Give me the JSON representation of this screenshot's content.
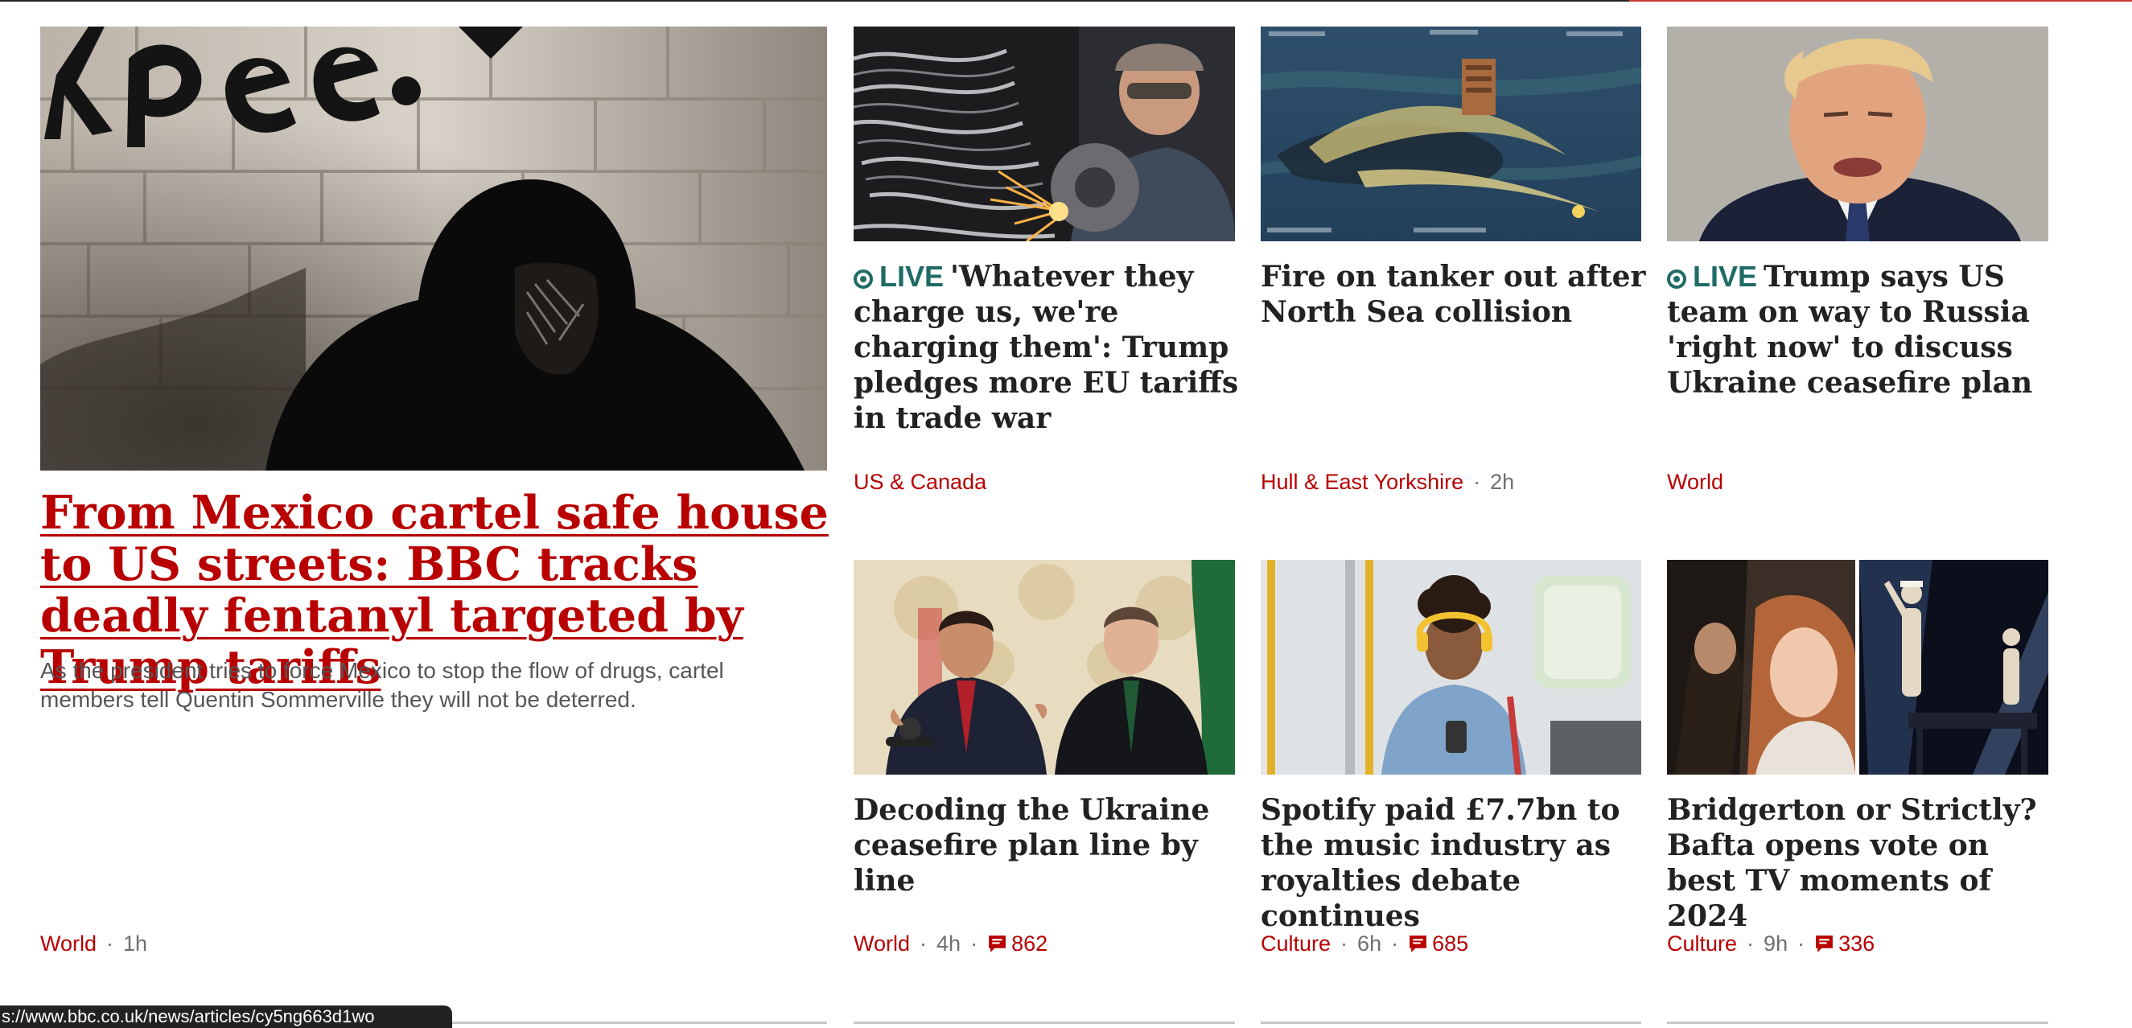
{
  "lead": {
    "image_alt": "Hooded man in front of graffiti brick wall",
    "headline": "From Mexico cartel safe house to US streets: BBC tracks deadly fentanyl targeted by Trump tariffs",
    "summary": "As the president tries to force Mexico to stop the flow of drugs, cartel members tell Quentin Sommerville they will not be deterred.",
    "tag": "World",
    "time": "1h"
  },
  "stories": [
    {
      "live": true,
      "live_label": "LIVE",
      "headline": "'Whatever they charge us, we're charging them': Trump pledges more EU tariffs in trade war",
      "tag": "US & Canada"
    },
    {
      "live": false,
      "headline": "Fire on tanker out after North Sea collision",
      "tag": "Hull & East Yorkshire",
      "time": "2h"
    },
    {
      "live": true,
      "live_label": "LIVE",
      "headline": "Trump says US team on way to Russia 'right now' to discuss Ukraine ceasefire plan",
      "tag": "World"
    },
    {
      "live": false,
      "headline": "Decoding the Ukraine ceasefire plan line by line",
      "tag": "World",
      "time": "4h",
      "comments": "862"
    },
    {
      "live": false,
      "headline": "Spotify paid £7.7bn to the music industry as royalties debate continues",
      "tag": "Culture",
      "time": "6h",
      "comments": "685"
    },
    {
      "live": false,
      "headline": "Bridgerton or Strictly? Bafta opens vote on best TV moments of 2024",
      "tag": "Culture",
      "time": "9h",
      "comments": "336"
    }
  ],
  "status_url": "s://www.bbc.co.uk/news/articles/cy5ng663d1wo",
  "colors": {
    "accent_red": "#b80000",
    "live_green": "#1f6b66",
    "text": "#202224",
    "muted": "#6e6e73"
  }
}
